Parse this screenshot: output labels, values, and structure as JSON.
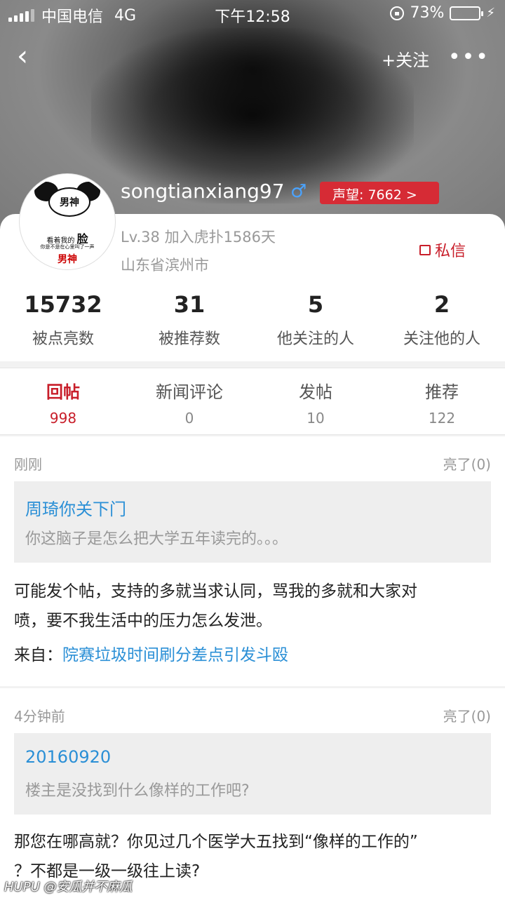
{
  "status_bar": {
    "carrier": "中国电信",
    "network": "4G",
    "time": "下午12:58",
    "battery": "73%",
    "battery_level": 0.73
  },
  "nav": {
    "back_icon": "chevron-left",
    "follow_label": "+关注",
    "more_icon": "ellipsis"
  },
  "profile": {
    "username": "songtianxiang97",
    "gender_symbol": "♂",
    "reputation": "声望: 7662 >",
    "level": "Lv.38 加入虎扑1586天",
    "location": "山东省滨州市",
    "message_label": "私信",
    "avatar": {
      "title": "男神",
      "line1": "看着我的",
      "line1_bold": "脸",
      "line2": "你是不是在心里叫了一声",
      "line3": "男神"
    }
  },
  "stats": [
    {
      "value": "15732",
      "label": "被点亮数"
    },
    {
      "value": "31",
      "label": "被推荐数"
    },
    {
      "value": "5",
      "label": "他关注的人"
    },
    {
      "value": "2",
      "label": "关注他的人"
    }
  ],
  "tabs": [
    {
      "label": "回帖",
      "count": "998",
      "active": true
    },
    {
      "label": "新闻评论",
      "count": "0"
    },
    {
      "label": "发帖",
      "count": "10"
    },
    {
      "label": "推荐",
      "count": "122"
    }
  ],
  "posts": [
    {
      "time": "刚刚",
      "likes": "亮了(0)",
      "quote_user": "周琦你关下门",
      "quote_text": "你这脑子是怎么把大学五年读完的。。。",
      "body_line1": "可能发个帖，支持的多就当求认同，骂我的多就和大家对",
      "body_line2": "喷，要不我生活中的压力怎么发泄。",
      "source_prefix": "来自：",
      "source_link": "院赛垃圾时间刷分差点引发斗殴"
    },
    {
      "time": "4分钟前",
      "likes": "亮了(0)",
      "quote_user": "20160920",
      "quote_text": "楼主是没找到什么像样的工作吧?",
      "body_line1": "那您在哪高就？你见过几个医学大五找到“像样的工作的”",
      "body_line2": "？不都是一级一级往上读?"
    }
  ],
  "watermark": "HUPU @安瓜并不麻瓜"
}
